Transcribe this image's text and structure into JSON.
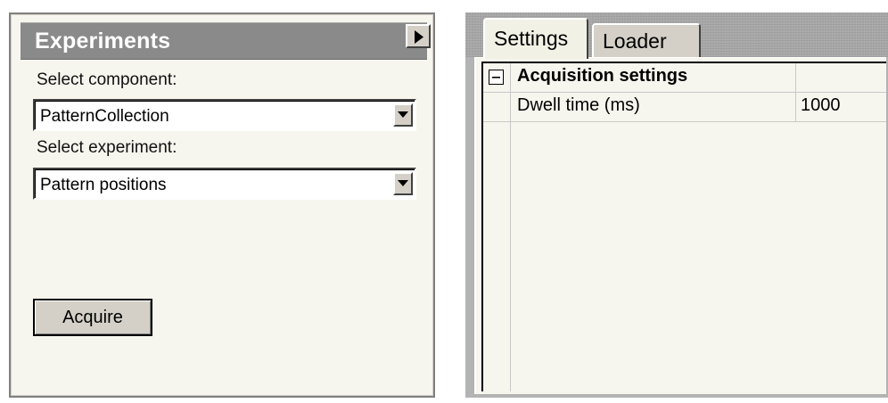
{
  "experiments_panel": {
    "title": "Experiments",
    "expand_button_icon": "triangle-right-icon",
    "component_label": "Select component:",
    "component_value": "PatternCollection",
    "experiment_label": "Select experiment:",
    "experiment_value": "Pattern positions",
    "acquire_label": "Acquire"
  },
  "tabs": [
    {
      "label": "Settings",
      "active": true
    },
    {
      "label": "Loader",
      "active": false
    }
  ],
  "property_grid": {
    "category": {
      "label": "Acquisition settings",
      "expanded": true,
      "toggle_icon": "minus-box-icon"
    },
    "properties": [
      {
        "name": "Dwell time (ms)",
        "value": "1000"
      }
    ]
  },
  "colors": {
    "header_bg": "#8a8a8a",
    "panel_bg": "#f7f6ee",
    "button_face": "#d4d0c8"
  }
}
